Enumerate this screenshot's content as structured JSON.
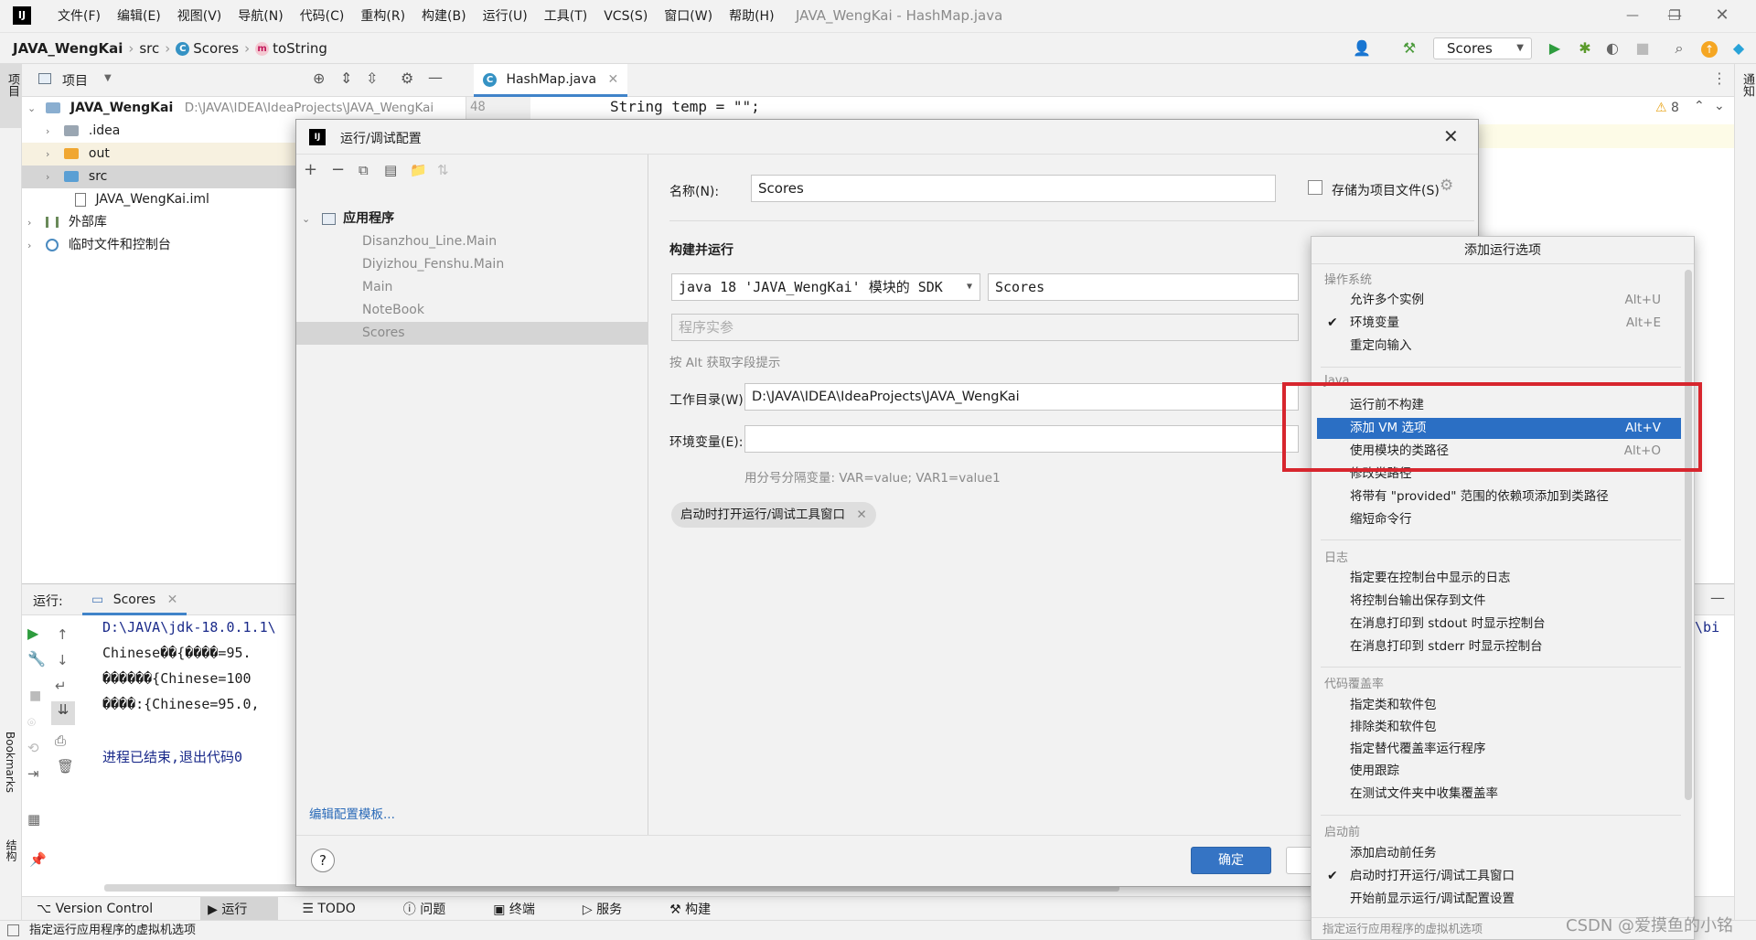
{
  "app": {
    "menu": [
      "文件(F)",
      "编辑(E)",
      "视图(V)",
      "导航(N)",
      "代码(C)",
      "重构(R)",
      "构建(B)",
      "运行(U)",
      "工具(T)",
      "VCS(S)",
      "窗口(W)",
      "帮助(H)"
    ],
    "window_title": "JAVA_WengKai - HashMap.java",
    "logo": "IJ"
  },
  "navbar": {
    "project": "JAVA_WengKai",
    "src": "src",
    "class": "Scores",
    "method": "toString",
    "run_config": "Scores"
  },
  "left_stripe": {
    "project_label": "项目",
    "bookmarks_label": "Bookmarks",
    "structure_label": "结构"
  },
  "right_stripe": {
    "notifications_label": "通知"
  },
  "project_panel": {
    "title": "项目",
    "tree": [
      {
        "label": "JAVA_WengKai",
        "path": "D:\\JAVA\\IDEA\\IdeaProjects\\JAVA_WengKai"
      },
      {
        "label": ".idea"
      },
      {
        "label": "out"
      },
      {
        "label": "src"
      },
      {
        "label": "JAVA_WengKai.iml"
      },
      {
        "label": "外部库"
      },
      {
        "label": "临时文件和控制台"
      }
    ]
  },
  "editor": {
    "tab": "HashMap.java",
    "line_no": "48",
    "code": "String temp = \"\";",
    "warnings": "8"
  },
  "run_panel": {
    "label": "运行:",
    "tab": "Scores",
    "output": [
      "D:\\JAVA\\jdk-18.0.1.1\\",
      "Chinese��{����=95.",
      "������{Chinese=100",
      "����:{Chinese=95.0,",
      "",
      "进程已结束,退出代码0"
    ],
    "right_fragment": "3\\bi"
  },
  "bottom_tools": [
    "Version Control",
    "运行",
    "TODO",
    "问题",
    "终端",
    "服务",
    "构建"
  ],
  "status": {
    "text": "指定运行应用程序的虚拟机选项",
    "watermark": "CSDN @爱摸鱼的小铭"
  },
  "dialog": {
    "title": "运行/调试配置",
    "category": "应用程序",
    "configs": [
      "Disanzhou_Line.Main",
      "Diyizhou_Fenshu.Main",
      "Main",
      "NoteBook",
      "Scores"
    ],
    "edit_templates": "编辑配置模板...",
    "name_label": "名称(N):",
    "name_value": "Scores",
    "store_label": "存储为项目文件(S)",
    "build_run": "构建并运行",
    "sdk_value": "java 18 'JAVA_WengKai' 模块的 SDK",
    "main_class": "Scores",
    "program_args_placeholder": "程序实参",
    "alt_hint": "按 Alt 获取字段提示",
    "workdir_label": "工作目录(W):",
    "workdir_value": "D:\\JAVA\\IDEA\\IdeaProjects\\JAVA_WengKai",
    "env_label": "环境变量(E):",
    "env_hint": "用分号分隔变量: VAR=value; VAR1=value1",
    "chip": "启动时打开运行/调试工具窗口",
    "ok": "确定",
    "help": "?"
  },
  "popup": {
    "title": "添加运行选项",
    "sections": [
      {
        "title": "操作系统",
        "items": [
          {
            "label": "允许多个实例",
            "shortcut": "Alt+U",
            "checked": false
          },
          {
            "label": "环境变量",
            "shortcut": "Alt+E",
            "checked": true
          },
          {
            "label": "重定向输入",
            "shortcut": "",
            "checked": false
          }
        ]
      },
      {
        "title": "Java",
        "items": [
          {
            "label": "运行前不构建",
            "shortcut": "",
            "checked": false
          },
          {
            "label": "添加 VM 选项",
            "shortcut": "Alt+V",
            "checked": false,
            "selected": true
          },
          {
            "label": "使用模块的类路径",
            "shortcut": "Alt+O",
            "checked": false
          },
          {
            "label": "修改类路径",
            "shortcut": "",
            "checked": false
          },
          {
            "label": "将带有 \"provided\" 范围的依赖项添加到类路径",
            "shortcut": "",
            "checked": false
          },
          {
            "label": "缩短命令行",
            "shortcut": "",
            "checked": false
          }
        ]
      },
      {
        "title": "日志",
        "items": [
          {
            "label": "指定要在控制台中显示的日志",
            "shortcut": "",
            "checked": false
          },
          {
            "label": "将控制台输出保存到文件",
            "shortcut": "",
            "checked": false
          },
          {
            "label": "在消息打印到 stdout 时显示控制台",
            "shortcut": "",
            "checked": false
          },
          {
            "label": "在消息打印到 stderr 时显示控制台",
            "shortcut": "",
            "checked": false
          }
        ]
      },
      {
        "title": "代码覆盖率",
        "items": [
          {
            "label": "指定类和软件包",
            "shortcut": "",
            "checked": false
          },
          {
            "label": "排除类和软件包",
            "shortcut": "",
            "checked": false
          },
          {
            "label": "指定替代覆盖率运行程序",
            "shortcut": "",
            "checked": false
          },
          {
            "label": "使用跟踪",
            "shortcut": "",
            "checked": false
          },
          {
            "label": "在测试文件夹中收集覆盖率",
            "shortcut": "",
            "checked": false
          }
        ]
      },
      {
        "title": "启动前",
        "items": [
          {
            "label": "添加启动前任务",
            "shortcut": "",
            "checked": false
          },
          {
            "label": "启动时打开运行/调试工具窗口",
            "shortcut": "",
            "checked": true
          },
          {
            "label": "开始前显示运行/调试配置设置",
            "shortcut": "",
            "checked": false
          }
        ]
      }
    ],
    "footer": "指定运行应用程序的虚拟机选项"
  },
  "colors": {
    "selection": "#2b6fc4",
    "highlight_box": "#d7262e",
    "ok_button": "#3574c4"
  }
}
